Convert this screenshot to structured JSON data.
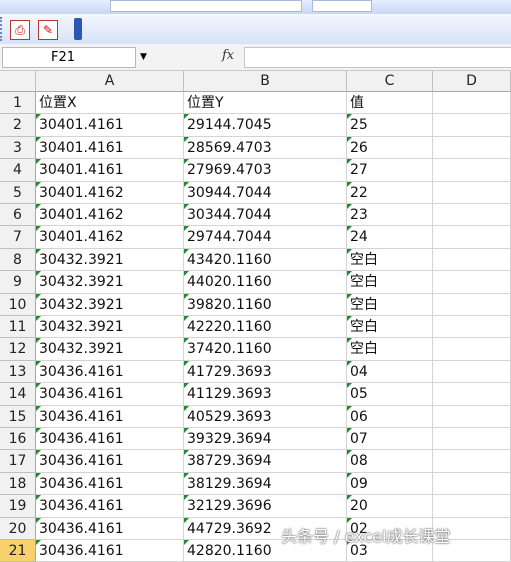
{
  "namebox": {
    "value": "F21"
  },
  "formula_bar": {
    "fx_label": "fx",
    "value": ""
  },
  "columns": [
    "A",
    "B",
    "C",
    "D"
  ],
  "rows": [
    {
      "num": "1",
      "a": "位置X",
      "b": "位置Y",
      "c": "值"
    },
    {
      "num": "2",
      "a": "30401.4161",
      "b": "29144.7045",
      "c": "25"
    },
    {
      "num": "3",
      "a": "30401.4161",
      "b": "28569.4703",
      "c": "26"
    },
    {
      "num": "4",
      "a": "30401.4161",
      "b": "27969.4703",
      "c": "27"
    },
    {
      "num": "5",
      "a": "30401.4162",
      "b": "30944.7044",
      "c": "22"
    },
    {
      "num": "6",
      "a": "30401.4162",
      "b": "30344.7044",
      "c": "23"
    },
    {
      "num": "7",
      "a": "30401.4162",
      "b": "29744.7044",
      "c": "24"
    },
    {
      "num": "8",
      "a": "30432.3921",
      "b": "43420.1160",
      "c": "空白"
    },
    {
      "num": "9",
      "a": "30432.3921",
      "b": "44020.1160",
      "c": "空白"
    },
    {
      "num": "10",
      "a": "30432.3921",
      "b": "39820.1160",
      "c": "空白"
    },
    {
      "num": "11",
      "a": "30432.3921",
      "b": "42220.1160",
      "c": "空白"
    },
    {
      "num": "12",
      "a": "30432.3921",
      "b": "37420.1160",
      "c": "空白"
    },
    {
      "num": "13",
      "a": "30436.4161",
      "b": "41729.3693",
      "c": "04"
    },
    {
      "num": "14",
      "a": "30436.4161",
      "b": "41129.3693",
      "c": "05"
    },
    {
      "num": "15",
      "a": "30436.4161",
      "b": "40529.3693",
      "c": "06"
    },
    {
      "num": "16",
      "a": "30436.4161",
      "b": "39329.3694",
      "c": "07"
    },
    {
      "num": "17",
      "a": "30436.4161",
      "b": "38729.3694",
      "c": "08"
    },
    {
      "num": "18",
      "a": "30436.4161",
      "b": "38129.3694",
      "c": "09"
    },
    {
      "num": "19",
      "a": "30436.4161",
      "b": "32129.3696",
      "c": "20"
    },
    {
      "num": "20",
      "a": "30436.4161",
      "b": "44729.3692",
      "c": "02"
    },
    {
      "num": "21",
      "a": "30436.4161",
      "b": "42820.1160",
      "c": "03"
    }
  ],
  "watermark": "头条号 / excel成长课堂"
}
